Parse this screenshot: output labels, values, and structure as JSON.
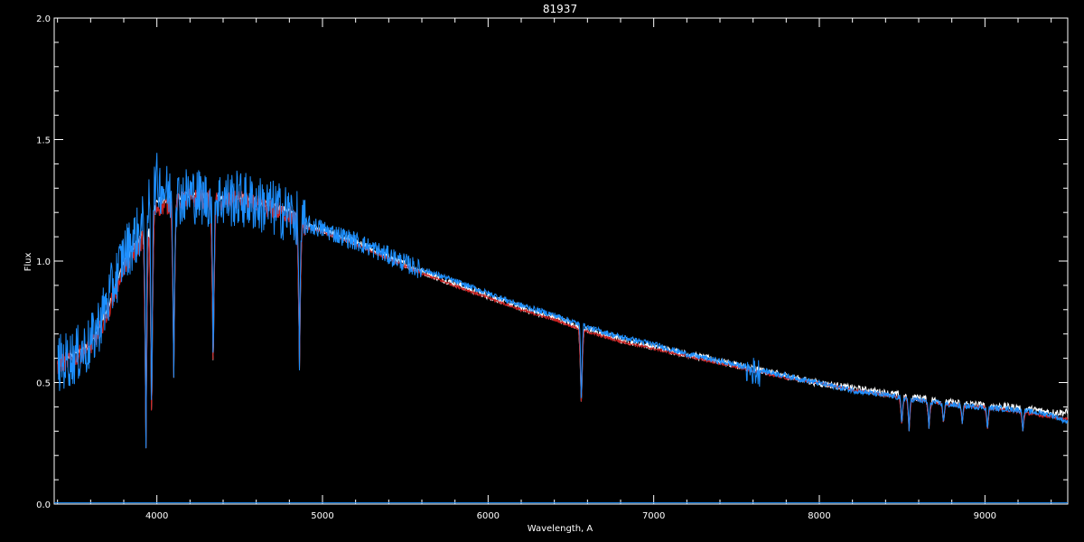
{
  "chart_data": {
    "type": "line",
    "title": "81937",
    "xlabel": "Wavelength, A",
    "ylabel": "Flux",
    "xlim": [
      3380,
      9500
    ],
    "ylim": [
      0.0,
      2.0
    ],
    "x_ticks": [
      4000,
      5000,
      6000,
      7000,
      8000,
      9000
    ],
    "x_tick_labels": [
      "4000",
      "5000",
      "6000",
      "7000",
      "8000",
      "9000"
    ],
    "y_ticks": [
      0.0,
      0.5,
      1.0,
      1.5,
      2.0
    ],
    "y_tick_labels": [
      "0.0",
      "0.5",
      "1.0",
      "1.5",
      "2.0"
    ],
    "grid": false,
    "background": "#000000",
    "series": [
      {
        "color": "#ffffff",
        "x": [
          3400,
          3500,
          3600,
          3700,
          3800,
          3900,
          4000,
          4100,
          4200,
          4300,
          4400,
          4500,
          4600,
          4700,
          4800,
          4900,
          5000,
          5200,
          5400,
          5600,
          5800,
          6000,
          6200,
          6400,
          6600,
          6800,
          7000,
          7200,
          7400,
          7600,
          7800,
          8000,
          8200,
          8400,
          8600,
          8800,
          9000,
          9200,
          9400,
          9500
        ],
        "y": [
          0.58,
          0.62,
          0.66,
          0.8,
          1.0,
          1.1,
          1.25,
          1.26,
          1.28,
          1.27,
          1.26,
          1.27,
          1.25,
          1.23,
          1.21,
          1.15,
          1.13,
          1.08,
          1.02,
          0.96,
          0.91,
          0.86,
          0.81,
          0.77,
          0.72,
          0.68,
          0.65,
          0.62,
          0.59,
          0.56,
          0.53,
          0.5,
          0.48,
          0.46,
          0.44,
          0.42,
          0.41,
          0.4,
          0.38,
          0.38
        ]
      },
      {
        "color": "#cc2222",
        "x": [
          3400,
          3500,
          3600,
          3700,
          3800,
          3900,
          4000,
          4100,
          4200,
          4300,
          4400,
          4500,
          4600,
          4700,
          4800,
          4900,
          5000,
          5200,
          5400,
          5600,
          5800,
          6000,
          6200,
          6400,
          6600,
          6800,
          7000,
          7200,
          7400,
          7600,
          7800,
          8000,
          8200,
          8400,
          8600,
          8800,
          9000,
          9200,
          9400,
          9500
        ],
        "y": [
          0.58,
          0.61,
          0.65,
          0.79,
          0.98,
          1.08,
          1.23,
          1.24,
          1.27,
          1.26,
          1.25,
          1.26,
          1.24,
          1.22,
          1.2,
          1.14,
          1.12,
          1.07,
          1.01,
          0.95,
          0.9,
          0.85,
          0.8,
          0.76,
          0.71,
          0.67,
          0.64,
          0.61,
          0.58,
          0.55,
          0.52,
          0.5,
          0.47,
          0.45,
          0.43,
          0.41,
          0.4,
          0.38,
          0.36,
          0.35
        ]
      },
      {
        "color": "#1e90ff",
        "x": [
          3400,
          3500,
          3600,
          3700,
          3800,
          3900,
          4000,
          4100,
          4200,
          4300,
          4400,
          4500,
          4600,
          4700,
          4800,
          4900,
          5000,
          5200,
          5400,
          5600,
          5800,
          6000,
          6200,
          6400,
          6600,
          6800,
          7000,
          7200,
          7400,
          7600,
          7800,
          8000,
          8200,
          8400,
          8600,
          8800,
          9000,
          9200,
          9400,
          9500
        ],
        "y": [
          0.6,
          0.63,
          0.68,
          0.85,
          1.05,
          1.15,
          1.35,
          1.28,
          1.3,
          1.28,
          1.28,
          1.28,
          1.26,
          1.24,
          1.22,
          1.16,
          1.14,
          1.09,
          1.03,
          0.97,
          0.92,
          0.87,
          0.82,
          0.78,
          0.73,
          0.69,
          0.66,
          0.62,
          0.59,
          0.56,
          0.53,
          0.5,
          0.47,
          0.45,
          0.43,
          0.41,
          0.4,
          0.39,
          0.37,
          0.34
        ]
      }
    ],
    "absorption_lines": [
      {
        "x": 3934,
        "depth_to": 0.23
      },
      {
        "x": 3968,
        "depth_to": 0.3
      },
      {
        "x": 4102,
        "depth_to": 0.52
      },
      {
        "x": 4340,
        "depth_to": 0.52
      },
      {
        "x": 4861,
        "depth_to": 0.55
      },
      {
        "x": 6563,
        "depth_to": 0.39
      },
      {
        "x": 8498,
        "depth_to": 0.32
      },
      {
        "x": 8542,
        "depth_to": 0.3
      },
      {
        "x": 8662,
        "depth_to": 0.31
      },
      {
        "x": 8750,
        "depth_to": 0.33
      },
      {
        "x": 8863,
        "depth_to": 0.33
      },
      {
        "x": 9015,
        "depth_to": 0.3
      },
      {
        "x": 9229,
        "depth_to": 0.3
      }
    ]
  }
}
